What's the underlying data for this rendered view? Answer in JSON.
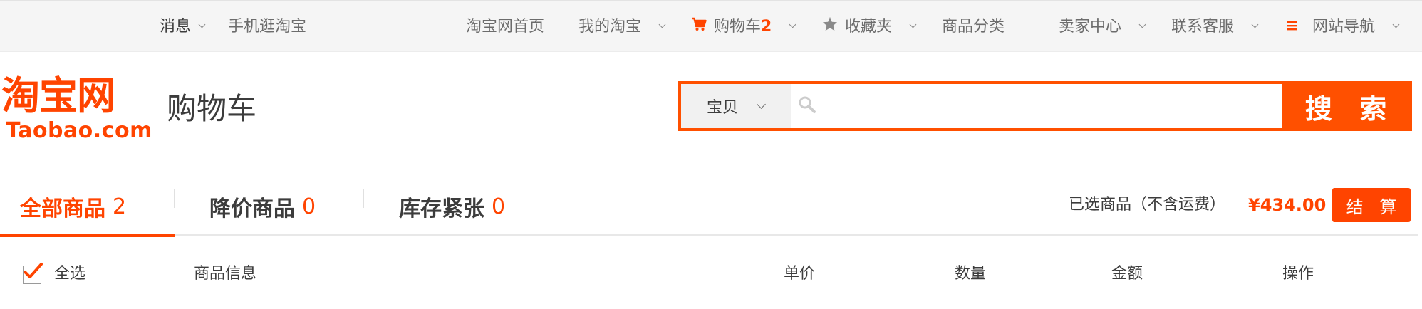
{
  "topbar": {
    "messages": "消息",
    "mobile": "手机逛淘宝",
    "home": "淘宝网首页",
    "my_taobao": "我的淘宝",
    "cart_label": "购物车",
    "cart_count": "2",
    "favorites": "收藏夹",
    "categories": "商品分类",
    "seller_center": "卖家中心",
    "customer_service": "联系客服",
    "site_nav": "网站导航"
  },
  "header": {
    "logo_cn": "淘宝网",
    "logo_en": "Taobao.com",
    "page_title": "购物车"
  },
  "search": {
    "category": "宝贝",
    "placeholder": "",
    "button_label": "搜 索"
  },
  "tabs": [
    {
      "label": "全部商品",
      "count": "2"
    },
    {
      "label": "降价商品",
      "count": "0"
    },
    {
      "label": "库存紧张",
      "count": "0"
    }
  ],
  "summary": {
    "selected_label": "已选商品（不含运费）",
    "total": "¥434.00",
    "checkout_label": "结 算"
  },
  "table_header": {
    "select_all": "全选",
    "product_info": "商品信息",
    "unit_price": "单价",
    "quantity": "数量",
    "amount": "金额",
    "operation": "操作"
  },
  "colors": {
    "accent": "#ff4400",
    "search_border": "#ff5000",
    "topbar_bg": "#f5f5f5"
  },
  "icons": {
    "cart": "cart-icon",
    "star": "star-icon",
    "menu": "menu-icon",
    "search": "magnifier-icon",
    "check": "check-icon"
  }
}
